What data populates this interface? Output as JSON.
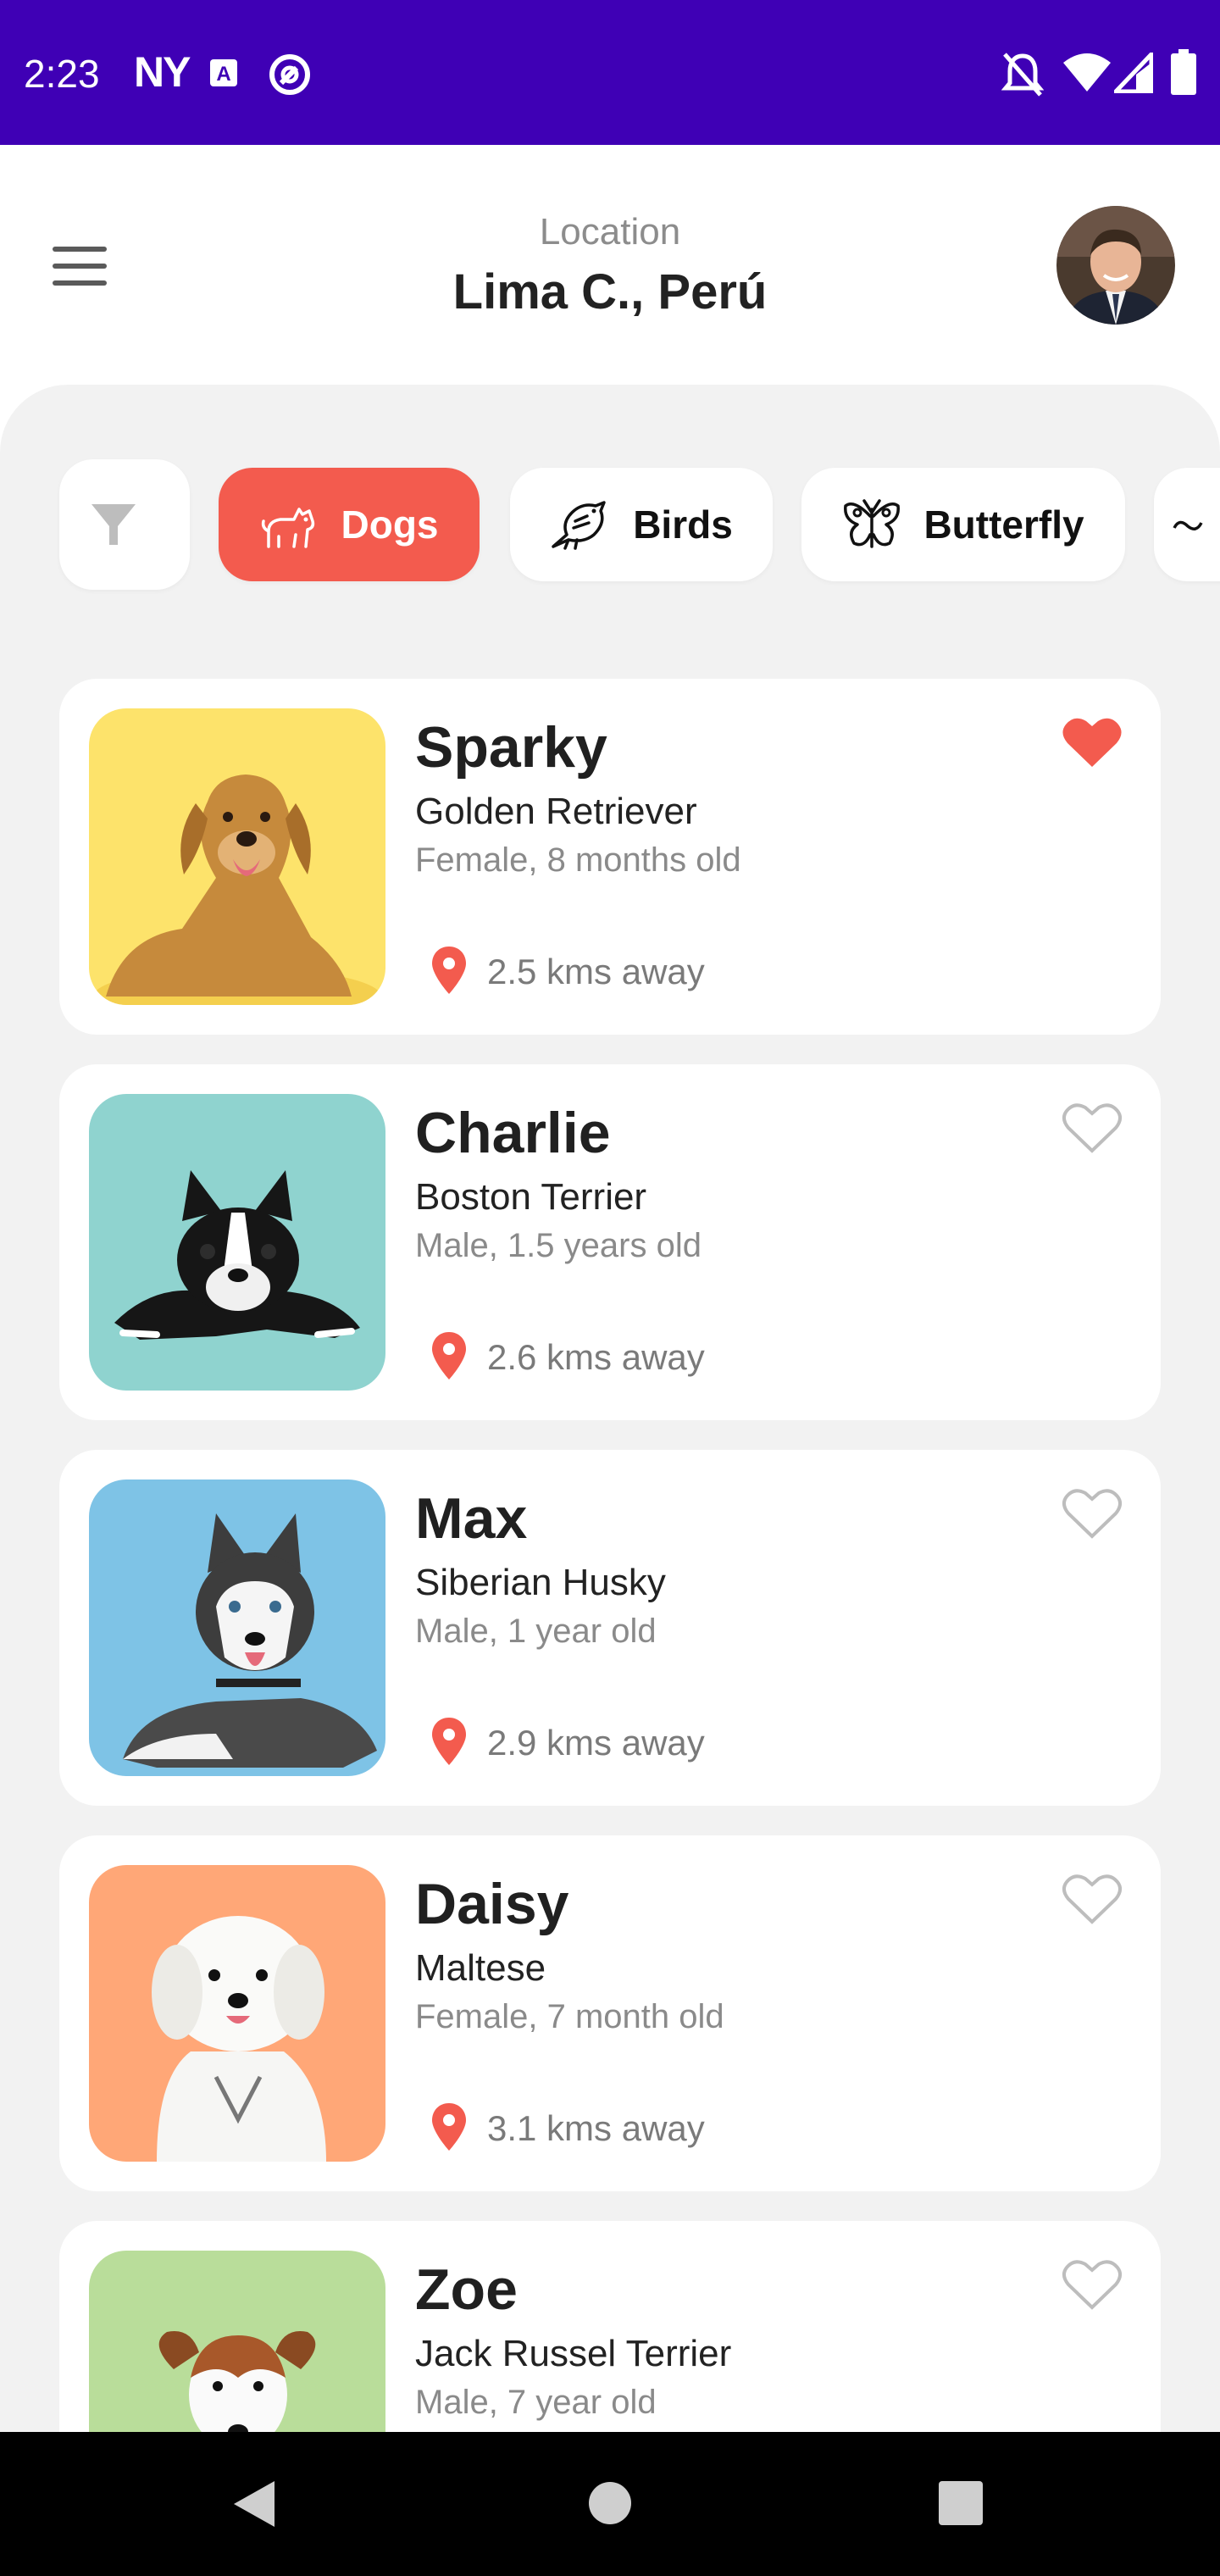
{
  "status_bar": {
    "time": "2:23",
    "carrier_label": "NY"
  },
  "header": {
    "location_label": "Location",
    "location_value": "Lima C., Perú"
  },
  "categories": [
    {
      "label": "Dogs",
      "icon": "dog-icon",
      "active": true
    },
    {
      "label": "Birds",
      "icon": "bird-icon",
      "active": false
    },
    {
      "label": "Butterfly",
      "icon": "butterfly-icon",
      "active": false
    }
  ],
  "pets": [
    {
      "name": "Sparky",
      "breed": "Golden Retriever",
      "info": "Female, 8 months old",
      "distance": "2.5 kms away",
      "favorite": true,
      "bg_color": "#fde36b"
    },
    {
      "name": "Charlie",
      "breed": "Boston Terrier",
      "info": "Male, 1.5 years old",
      "distance": "2.6 kms away",
      "favorite": false,
      "bg_color": "#8fd3cf"
    },
    {
      "name": "Max",
      "breed": "Siberian Husky",
      "info": "Male, 1 year old",
      "distance": "2.9 kms away",
      "favorite": false,
      "bg_color": "#7ec3e6"
    },
    {
      "name": "Daisy",
      "breed": "Maltese",
      "info": "Female, 7 month old",
      "distance": "3.1 kms away",
      "favorite": false,
      "bg_color": "#ffa777"
    },
    {
      "name": "Zoe",
      "breed": "Jack Russel Terrier",
      "info": "Male, 7 year old",
      "distance": "",
      "favorite": false,
      "bg_color": "#b9dd9a"
    }
  ],
  "colors": {
    "accent": "#f35b4e",
    "status_bar": "#3f00b5",
    "background": "#f2f2f2"
  }
}
